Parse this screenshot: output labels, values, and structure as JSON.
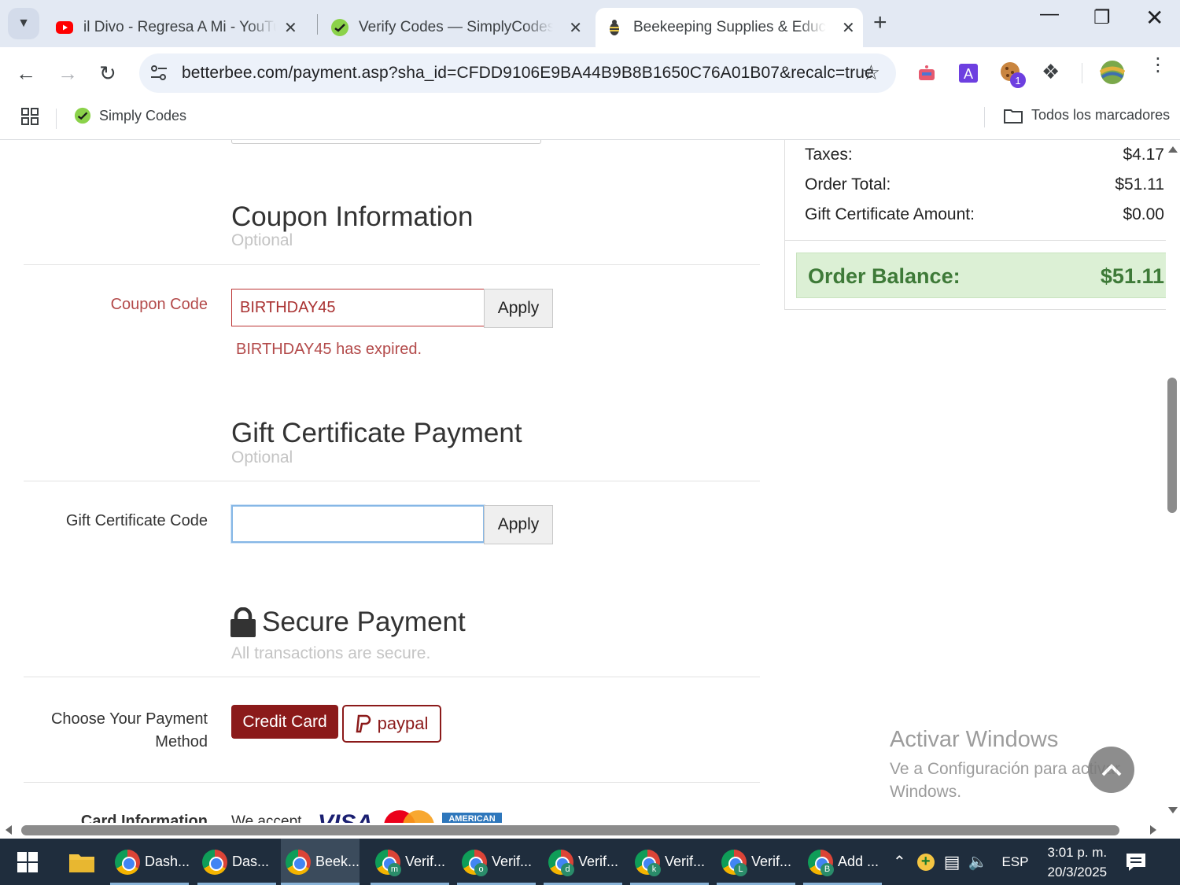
{
  "browser": {
    "tabs": [
      {
        "title": "il Divo - Regresa A Mi - YouTube",
        "icon": "youtube-icon",
        "active": false
      },
      {
        "title": "Verify Codes — SimplyCodes",
        "icon": "simplycodes-icon",
        "active": false
      },
      {
        "title": "Beekeeping Supplies & Education",
        "icon": "bee-icon",
        "active": true
      }
    ],
    "url": "betterbee.com/payment.asp?sha_id=CFDD9106E9BA44B9B8B1650C76A01B07&recalc=true",
    "extension_badge": "1",
    "bookmarks": [
      {
        "label": "Simply Codes"
      }
    ],
    "all_bookmarks_label": "Todos los marcadores"
  },
  "summary": {
    "rows": [
      {
        "label": "Taxes:",
        "value": "$4.17"
      },
      {
        "label": "Order Total:",
        "value": "$51.11"
      },
      {
        "label": "Gift Certificate Amount:",
        "value": "$0.00"
      }
    ],
    "balance_label": "Order Balance:",
    "balance_value": "$51.11"
  },
  "coupon": {
    "title": "Coupon Information",
    "subtitle": "Optional",
    "label": "Coupon Code",
    "value": "BIRTHDAY45",
    "apply_label": "Apply",
    "error": "BIRTHDAY45 has expired."
  },
  "gift": {
    "title": "Gift Certificate Payment",
    "subtitle": "Optional",
    "label": "Gift Certificate Code",
    "value": "",
    "apply_label": "Apply"
  },
  "secure": {
    "title": "Secure Payment",
    "subtitle": "All transactions are secure.",
    "method_label_line1": "Choose Your Payment",
    "method_label_line2": "Method",
    "credit_card_label": "Credit Card",
    "paypal_label": "paypal",
    "card_info_label": "Card Information",
    "we_accept": "We accept",
    "card_brands": [
      "VISA",
      "mastercard",
      "AMERICAN EXPRESS"
    ]
  },
  "watermark": {
    "line1": "Activar Windows",
    "line2": "Ve a Configuración para activar",
    "line3": "Windows."
  },
  "taskbar": {
    "items": [
      {
        "label": "Dash...",
        "badge": ""
      },
      {
        "label": "Das...",
        "badge": ""
      },
      {
        "label": "Beek...",
        "badge": ""
      },
      {
        "label": "Verif...",
        "badge": "m"
      },
      {
        "label": "Verif...",
        "badge": "o"
      },
      {
        "label": "Verif...",
        "badge": "d"
      },
      {
        "label": "Verif...",
        "badge": "k"
      },
      {
        "label": "Verif...",
        "badge": "L"
      },
      {
        "label": "Add ...",
        "badge": "B"
      }
    ],
    "language": "ESP",
    "time": "3:01 p. m.",
    "date": "20/3/2025"
  },
  "colors": {
    "brand": "#8b1a1a",
    "balance_bg": "#dcf0d5",
    "balance_text": "#3e7a38",
    "error": "#b34a4a"
  }
}
